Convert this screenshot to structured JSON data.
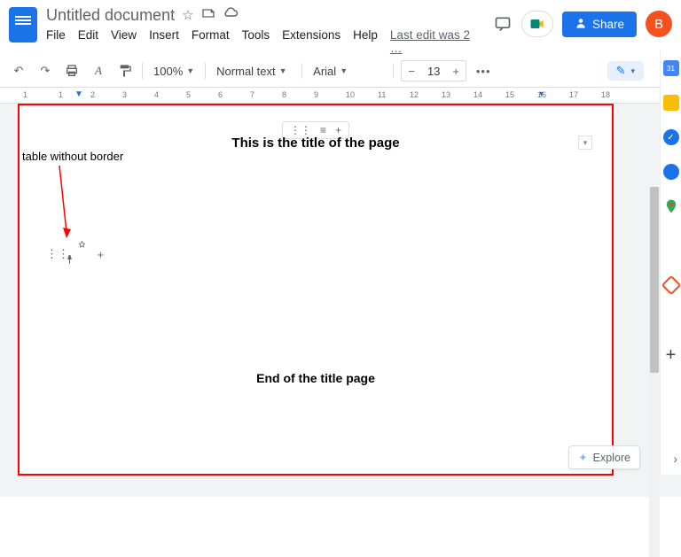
{
  "header": {
    "doc_title": "Untitled document",
    "menus": [
      "File",
      "Edit",
      "View",
      "Insert",
      "Format",
      "Tools",
      "Extensions",
      "Help"
    ],
    "last_edit": "Last edit was 2 …",
    "share_label": "Share",
    "avatar_initial": "B"
  },
  "toolbar": {
    "zoom": "100%",
    "style": "Normal text",
    "font": "Arial",
    "font_size": "13"
  },
  "ruler": {
    "marks": [
      "1",
      "1",
      "2",
      "3",
      "4",
      "5",
      "6",
      "7",
      "8",
      "9",
      "10",
      "11",
      "12",
      "13",
      "14",
      "15",
      "16",
      "17",
      "18"
    ]
  },
  "page": {
    "title": "This is the title of the page",
    "end_text": "End of the title page",
    "annotation": "table without border"
  },
  "explore": {
    "label": "Explore"
  },
  "icons": {
    "star": "☆",
    "move": "▭",
    "cloud": "☁",
    "undo": "↶",
    "redo": "↷",
    "print": "⎙",
    "spell": "A",
    "paint": "⟆",
    "minus": "−",
    "plus": "+",
    "pen": "✎",
    "caret_up": "^",
    "caret_down": "▾",
    "drag": "⋮⋮",
    "pin": "📌",
    "add": "+"
  }
}
